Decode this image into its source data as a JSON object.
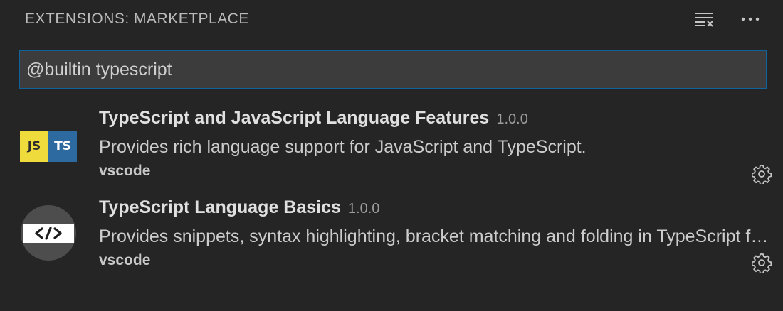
{
  "header": {
    "title": "EXTENSIONS: MARKETPLACE",
    "actions": [
      {
        "icon": "clear-results-icon"
      },
      {
        "icon": "more-actions-icon"
      }
    ]
  },
  "search": {
    "value": "@builtin typescript"
  },
  "extensions": [
    {
      "name": "TypeScript and JavaScript Language Features",
      "version": "1.0.0",
      "description": "Provides rich language support for JavaScript and TypeScript.",
      "publisher": "vscode",
      "icon": "js-ts-logo-icon",
      "icon_labels": [
        "JS",
        "TS"
      ]
    },
    {
      "name": "TypeScript Language Basics",
      "version": "1.0.0",
      "description": "Provides snippets, syntax highlighting, bracket matching and folding in TypeScript files.",
      "publisher": "vscode",
      "icon": "code-brackets-icon"
    }
  ],
  "colors": {
    "background": "#252526",
    "input_background": "#3c3c3c",
    "focus_border": "#0e639c",
    "js_yellow": "#f0db3c",
    "ts_blue": "#2d6aa0"
  }
}
